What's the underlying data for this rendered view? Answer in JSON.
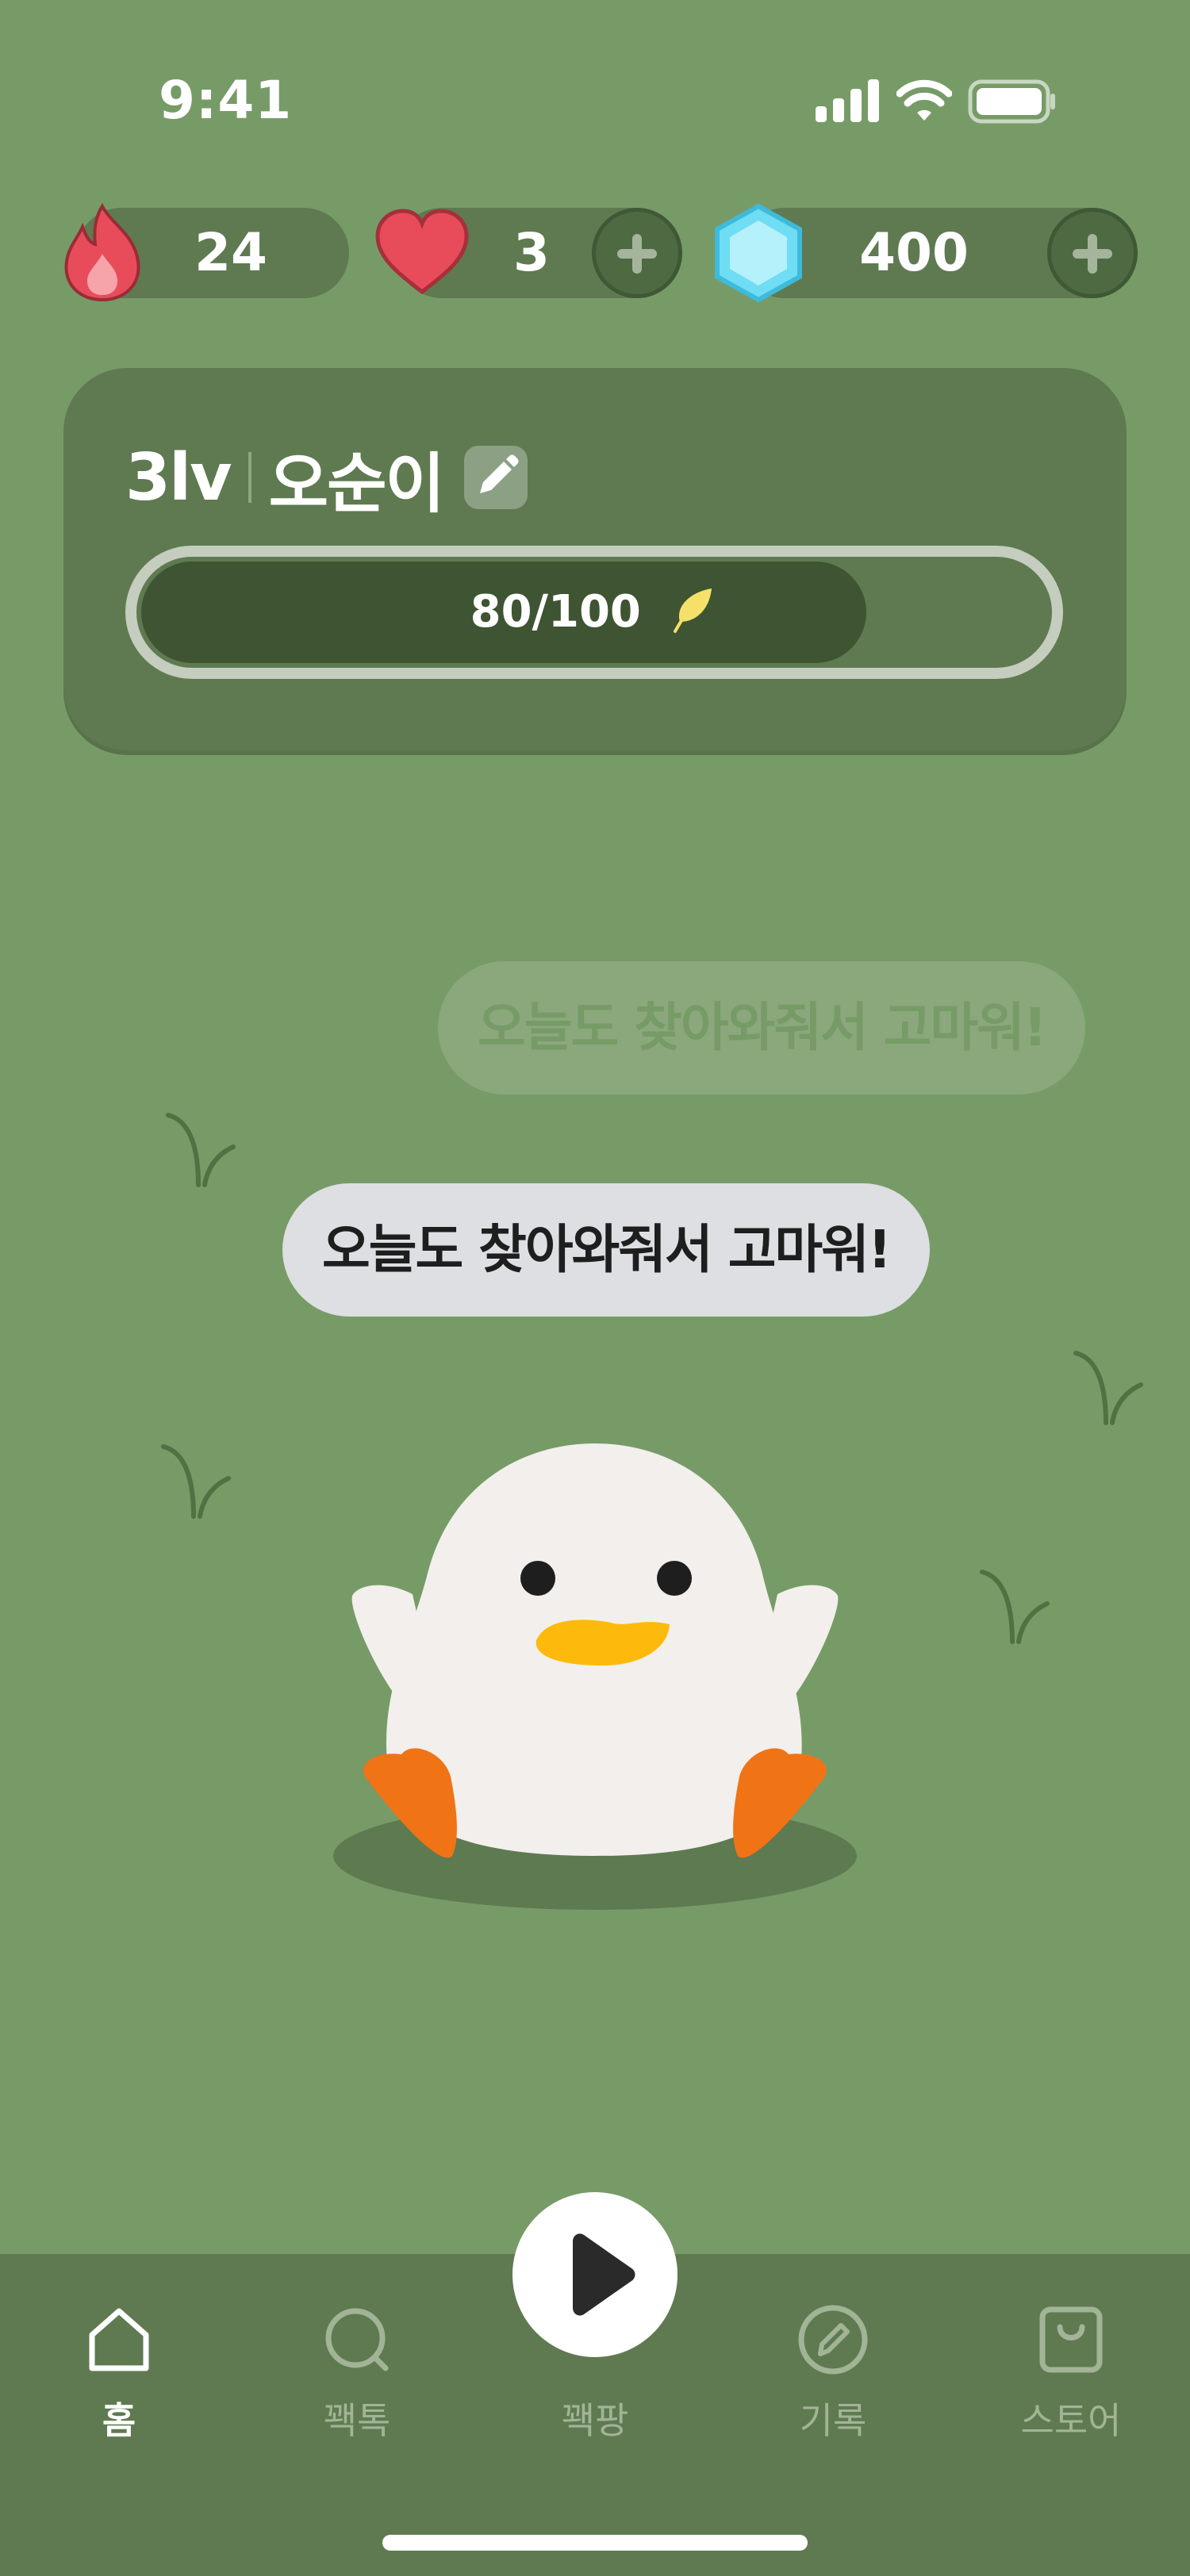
{
  "status_bar": {
    "time": "9:41"
  },
  "stats": {
    "streak": {
      "value": "24",
      "icon": "fire-icon"
    },
    "hearts": {
      "value": "3",
      "icon": "heart-icon"
    },
    "gems": {
      "value": "400",
      "icon": "gem-icon"
    }
  },
  "profile": {
    "level": "3lv",
    "name": "오순이",
    "progress_text": "80/100",
    "progress_fraction": 0.8
  },
  "bubbles": {
    "faded": "오늘도 찾아와줘서 고마워!",
    "main": "오늘도 찾아와줘서 고마워!"
  },
  "nav": {
    "items": [
      {
        "label": "홈",
        "icon": "home-icon",
        "active": true
      },
      {
        "label": "꽥톡",
        "icon": "chat-icon",
        "active": false
      },
      {
        "label": "꽥팡",
        "icon": "play-icon",
        "active": false
      },
      {
        "label": "기록",
        "icon": "pencil-icon",
        "active": false
      },
      {
        "label": "스토어",
        "icon": "shopping-bag-icon",
        "active": false
      }
    ]
  },
  "colors": {
    "background": "#779B67",
    "panel": "#5F7A51",
    "progress_fill": "#3E5432",
    "bubble": "#DDDFE2",
    "duck_body": "#F2EFEC",
    "duck_beak": "#FDBA0D",
    "duck_feet": "#F07316"
  }
}
